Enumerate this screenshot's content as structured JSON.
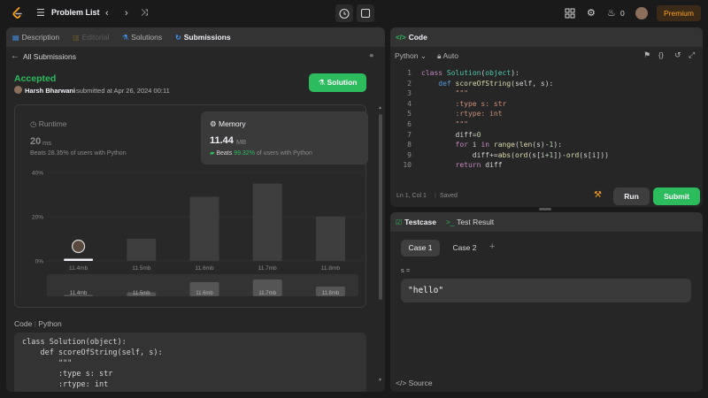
{
  "topbar": {
    "problem_list": "Problem List",
    "streak": "0",
    "premium": "Premium"
  },
  "left_tabs": [
    {
      "label": "Description",
      "icon": "description-icon"
    },
    {
      "label": "Editorial",
      "icon": "editorial-icon"
    },
    {
      "label": "Solutions",
      "icon": "solutions-icon"
    },
    {
      "label": "Submissions",
      "icon": "submissions-icon"
    }
  ],
  "submission": {
    "back_label": "All Submissions",
    "status": "Accepted",
    "user": "Harsh Bharwani",
    "submitted_text": "submitted at Apr 26, 2024 00:11",
    "solution_button": "Solution",
    "runtime": {
      "label": "Runtime",
      "value": "20",
      "unit": "ms",
      "beats_prefix": "Beats",
      "beats": "28.35%",
      "beats_suffix": "of users with Python"
    },
    "memory": {
      "label": "Memory",
      "value": "11.44",
      "unit": "MB",
      "beats_prefix": "Beats",
      "beats": "99.32%",
      "beats_suffix": "of users with Python"
    }
  },
  "chart_data": {
    "type": "bar",
    "categories": [
      "11.4mb",
      "11.5mb",
      "11.6mb",
      "11.7mb",
      "11.8mb"
    ],
    "values": [
      1,
      10,
      29,
      35,
      20
    ],
    "ylim": [
      0,
      40
    ],
    "yticks": [
      "40%",
      "20%",
      "0%"
    ],
    "highlight_index": 0,
    "overview_values": [
      3,
      9,
      32,
      38,
      22
    ],
    "grid": true
  },
  "code_section": {
    "header_code": "Code",
    "header_lang": "Python",
    "lines": [
      "class Solution(object):",
      "    def scoreOfString(self, s):",
      "        \"\"\"",
      "        :type s: str",
      "        :rtype: int"
    ]
  },
  "editor": {
    "title": "Code",
    "language": "Python",
    "auto_label": "Auto",
    "status": "Ln 1, Col 1",
    "saved": "Saved",
    "run": "Run",
    "submit": "Submit",
    "line_numbers": [
      "1",
      "2",
      "3",
      "4",
      "5",
      "6",
      "7",
      "8",
      "9",
      "10"
    ]
  },
  "testcase": {
    "tab_testcase": "Testcase",
    "tab_result": "Test Result",
    "cases": [
      "Case 1",
      "Case 2"
    ],
    "var_label": "s =",
    "value": "\"hello\"",
    "source": "Source"
  },
  "colors": {
    "accent_green": "#2cbb5d",
    "premium": "#ffa116",
    "bar": "#3e3e3e"
  }
}
